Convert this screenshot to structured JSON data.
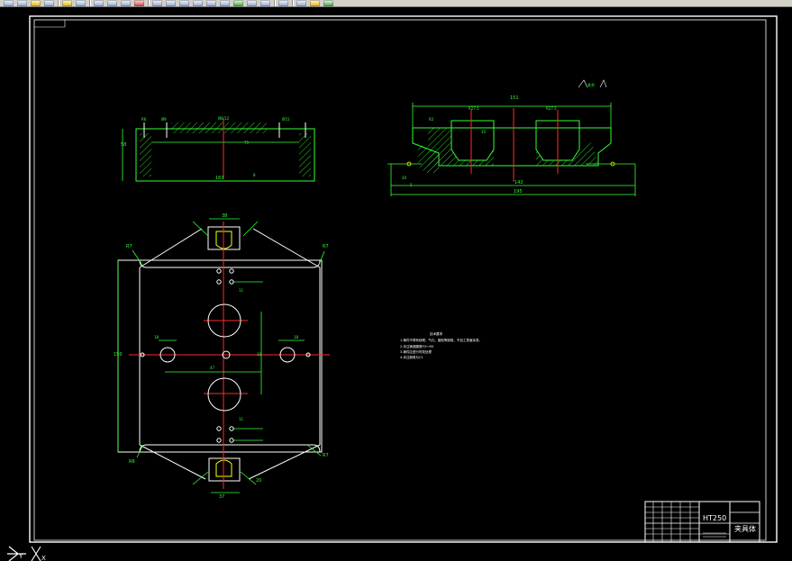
{
  "toolbar": {
    "icons": [
      "new-icon",
      "open-icon",
      "save-icon",
      "print-icon",
      "undo-icon",
      "redo-icon",
      "cut-icon",
      "copy-icon",
      "paste-icon",
      "match-properties-icon",
      "pan-icon",
      "zoom-icon",
      "zoom-window-icon",
      "properties-icon",
      "design-center-icon",
      "tool-palette-icon",
      "sheet-set-icon",
      "markup-icon",
      "quick-calc-icon",
      "help-icon",
      "layer-icon",
      "color-icon",
      "linetype-icon"
    ]
  },
  "drawing": {
    "title_block": {
      "material": "HT250",
      "name": "夹具体"
    },
    "dimensions": {
      "front": {
        "top_left_small": "R6",
        "top_mid_left": "Ø9",
        "top_mid": "Ø8/12",
        "top_right": "Ø15",
        "left_height": "58",
        "center_mark": "75",
        "bottom_width": "163",
        "bottom_mark": "8"
      },
      "side": {
        "top": "151",
        "left_bore": "R27.5",
        "right_bore": "R27.5",
        "left_r": "R2",
        "left_height": "5",
        "height_mid": "35",
        "width_mid": "142",
        "width_total": "195",
        "left_left": "20",
        "left_small": "5"
      },
      "plan": {
        "top_width": "38",
        "top_small_left": "R7",
        "top_small_right": "R7",
        "left_height": "150",
        "hole_left": "18",
        "hole_right": "18",
        "center_offset": "47",
        "mid_10": "10",
        "top_11": "11",
        "bottom_11": "11",
        "bottom_r": "R7",
        "bottom_left": "R6",
        "bottom_width": "37",
        "bottom_right_mark": "20"
      }
    },
    "notes": {
      "heading": "技术要求",
      "line1": "1.铸件不得有砂眼、气孔、缩松等缺陷，不加工表面涂漆。",
      "line2": "2.未注铸造圆角R3～R5",
      "line3": "3.铸件应进行时效处理",
      "line4": "4.未注倒角为C1"
    },
    "surface_symbol": "其余",
    "ucs": {
      "label_x": "X",
      "label_y": "Y"
    }
  },
  "colors": {
    "background": "#000000",
    "green": "#33ff33",
    "yellow": "#ffff00",
    "red": "#ff2a2a",
    "white": "#ffffff",
    "gray": "#d4d0c8"
  }
}
